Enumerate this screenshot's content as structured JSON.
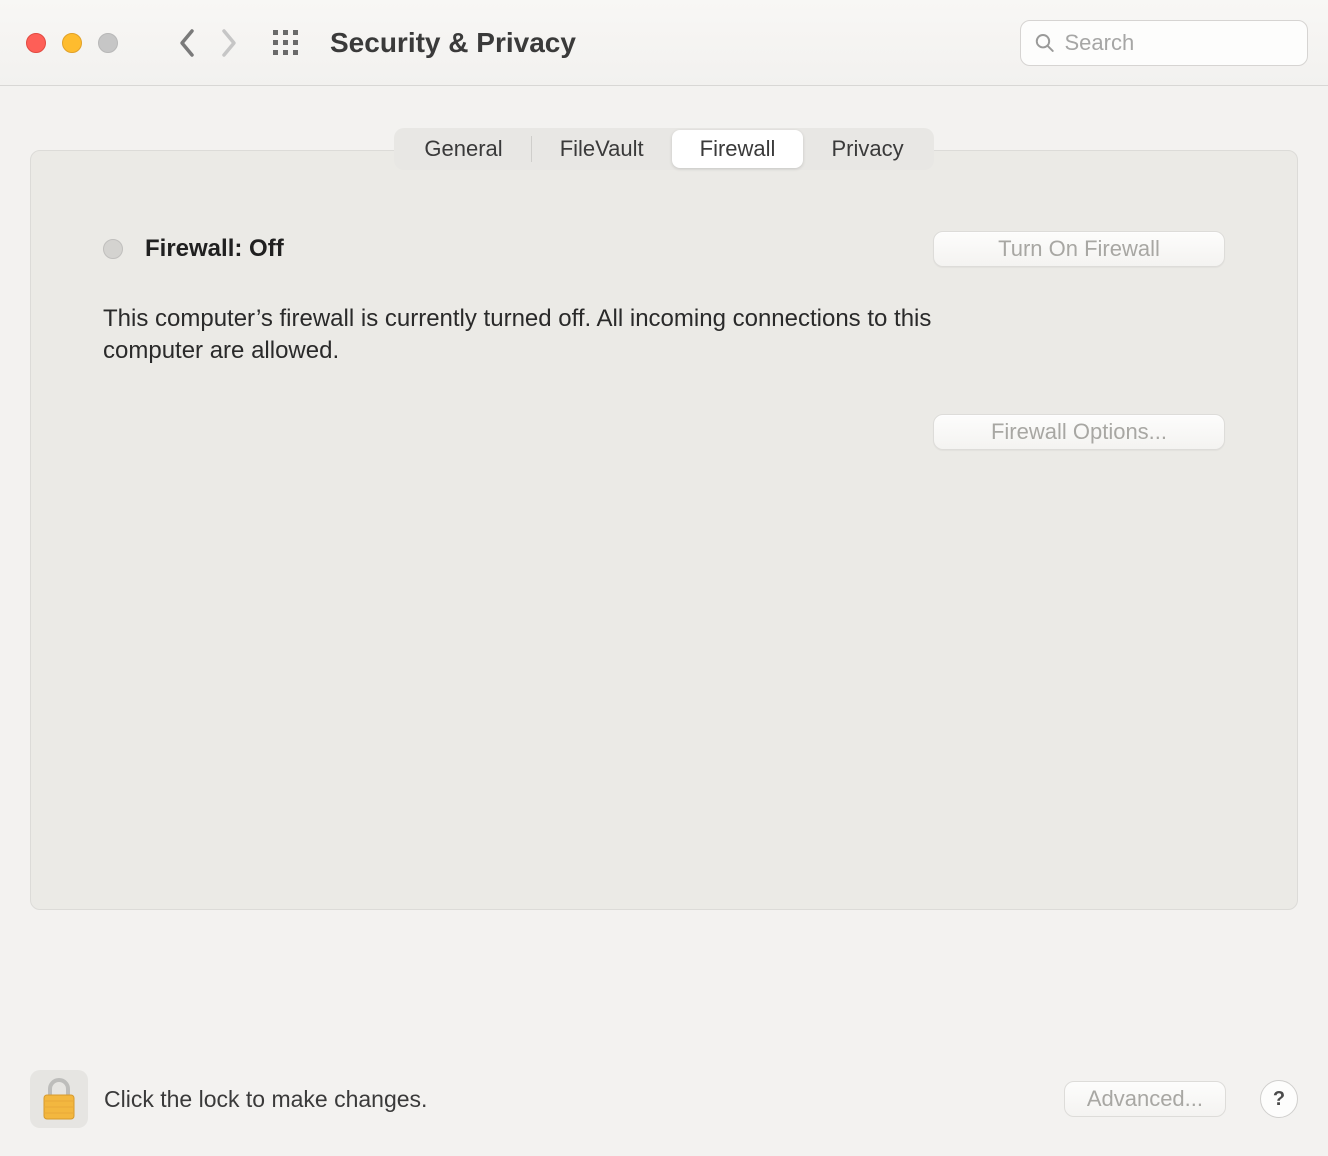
{
  "window": {
    "title": "Security & Privacy"
  },
  "search": {
    "placeholder": "Search",
    "value": ""
  },
  "tabs": [
    {
      "id": "general",
      "label": "General",
      "active": false
    },
    {
      "id": "filevault",
      "label": "FileVault",
      "active": false
    },
    {
      "id": "firewall",
      "label": "Firewall",
      "active": true
    },
    {
      "id": "privacy",
      "label": "Privacy",
      "active": false
    }
  ],
  "firewall": {
    "status_label": "Firewall: Off",
    "turn_on_label": "Turn On Firewall",
    "description": "This computer’s firewall is currently turned off. All incoming connections to this computer are allowed.",
    "options_label": "Firewall Options..."
  },
  "footer": {
    "lock_hint": "Click the lock to make changes.",
    "advanced_label": "Advanced...",
    "help_label": "?"
  }
}
